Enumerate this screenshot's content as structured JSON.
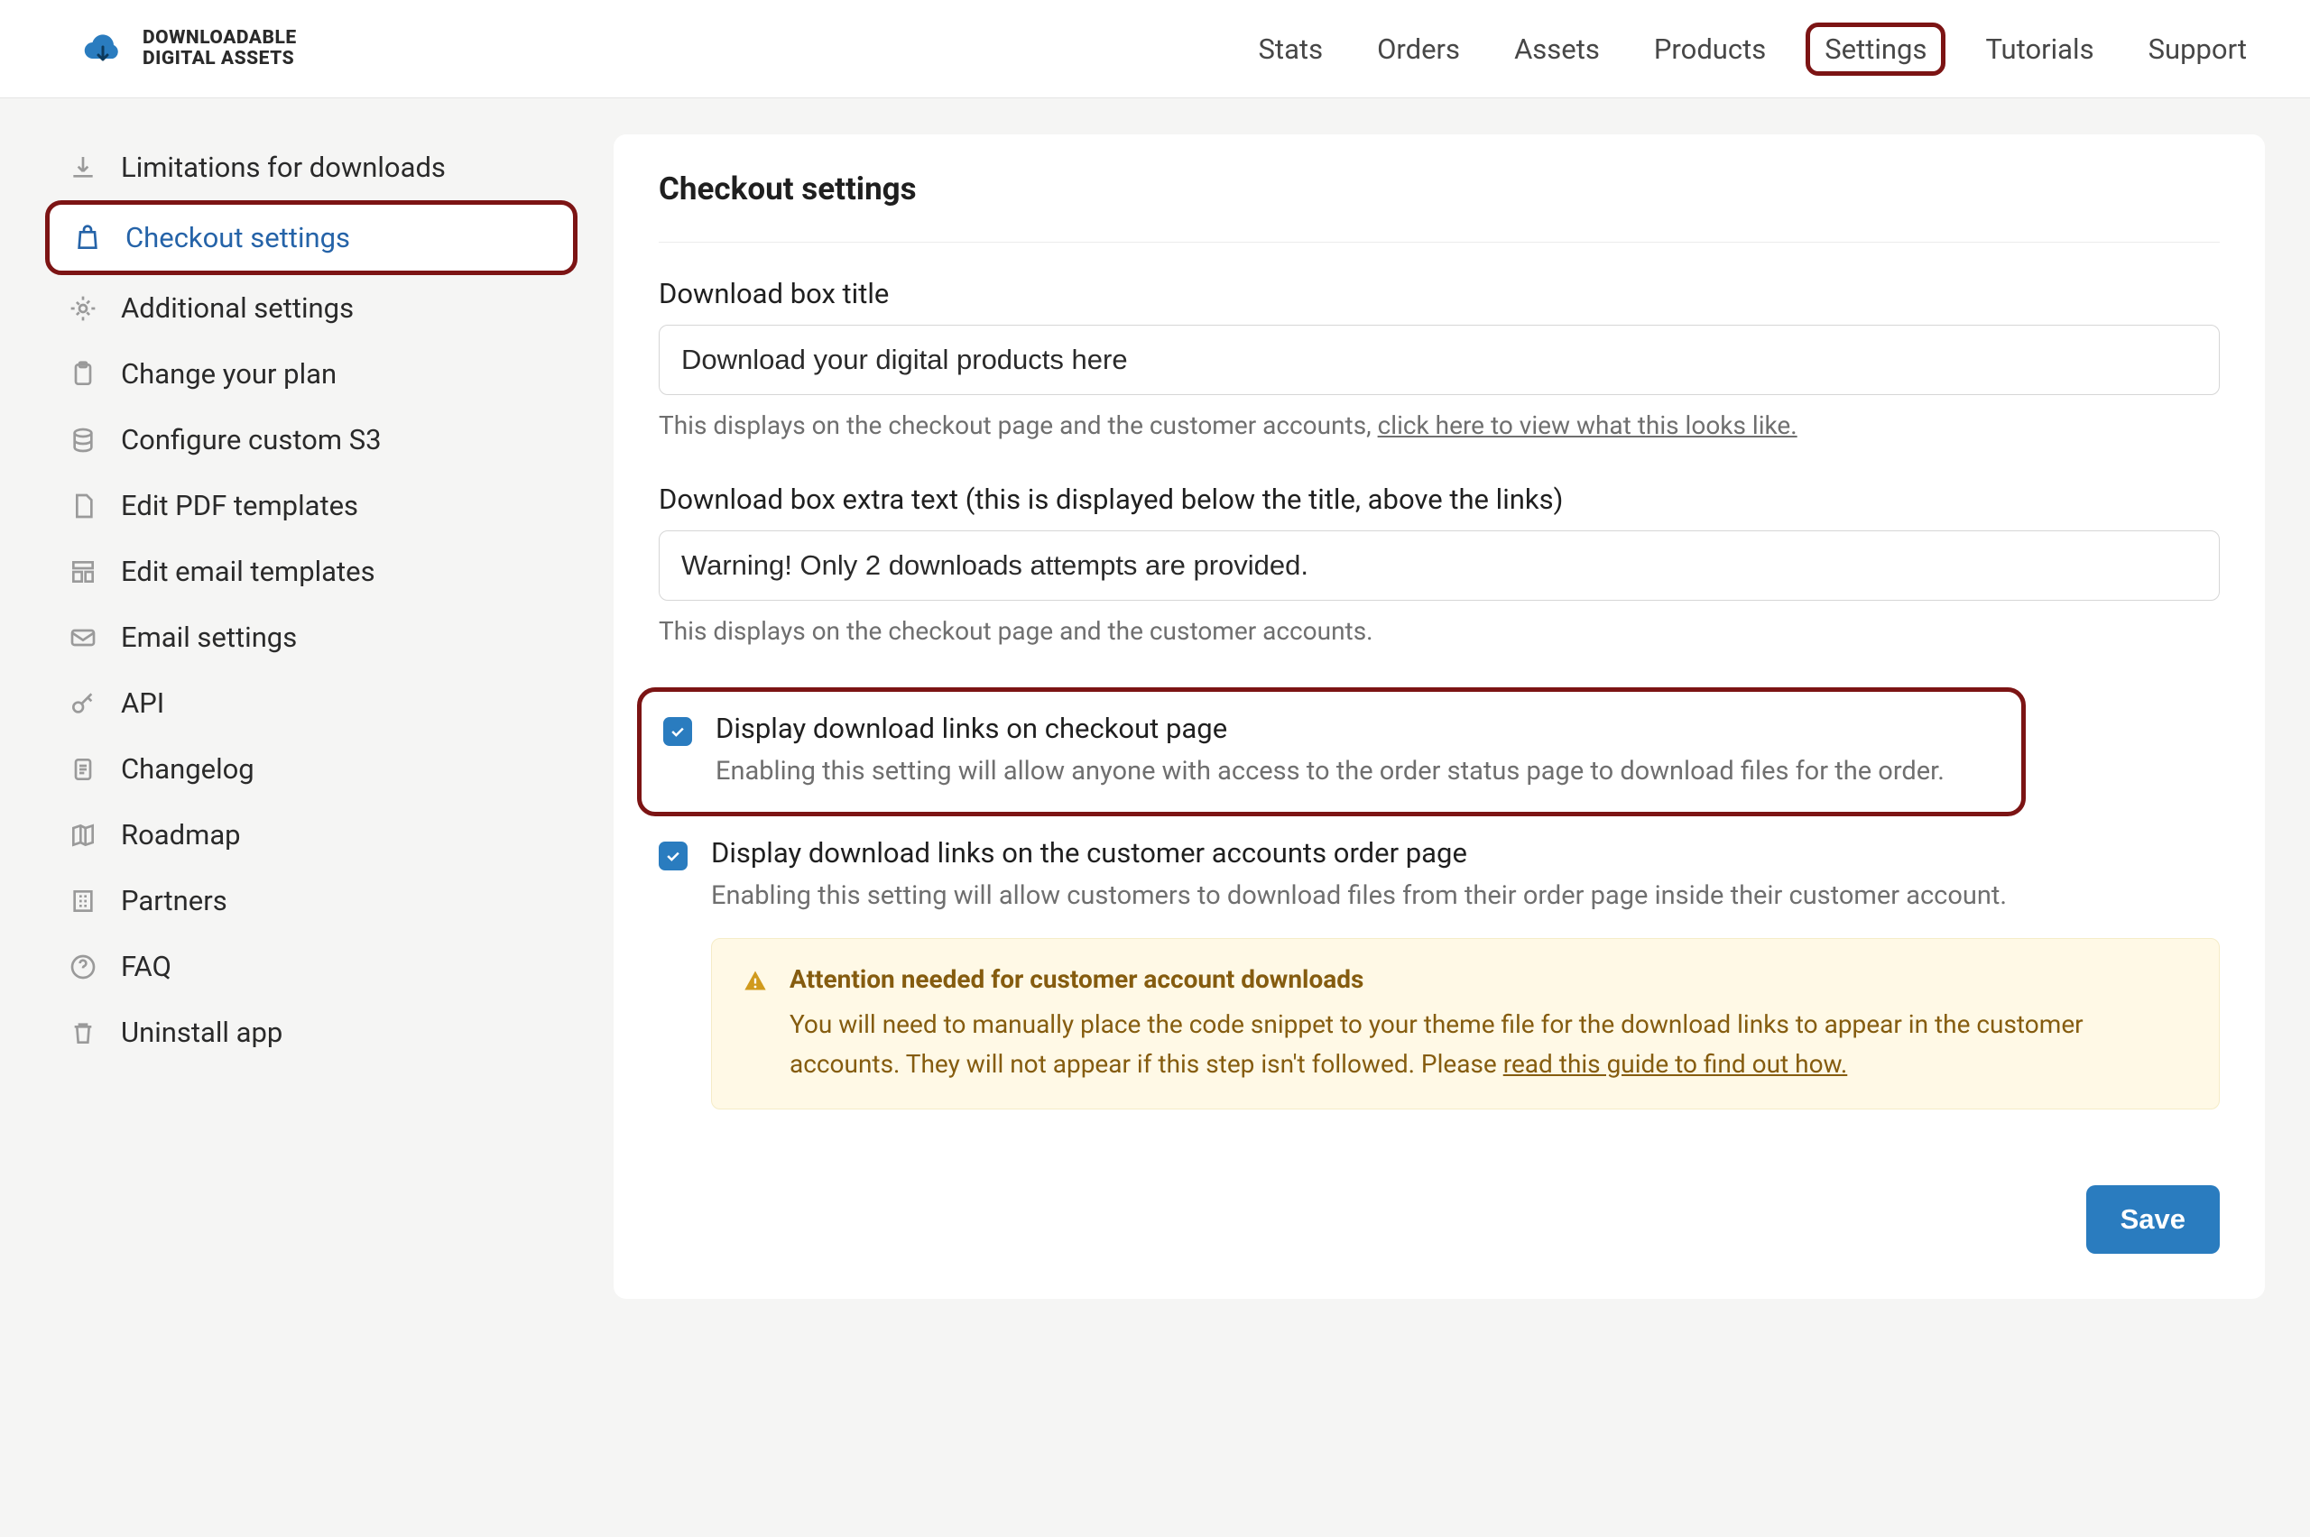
{
  "brand": {
    "line1": "DOWNLOADABLE",
    "line2": "DIGITAL ASSETS"
  },
  "nav": {
    "stats": "Stats",
    "orders": "Orders",
    "assets": "Assets",
    "products": "Products",
    "settings": "Settings",
    "tutorials": "Tutorials",
    "support": "Support"
  },
  "sidebar": {
    "limitations": "Limitations for downloads",
    "checkout": "Checkout settings",
    "additional": "Additional settings",
    "plan": "Change your plan",
    "s3": "Configure custom S3",
    "pdf": "Edit PDF templates",
    "email_templates": "Edit email templates",
    "email_settings": "Email settings",
    "api": "API",
    "changelog": "Changelog",
    "roadmap": "Roadmap",
    "partners": "Partners",
    "faq": "FAQ",
    "uninstall": "Uninstall app"
  },
  "page": {
    "title": "Checkout settings"
  },
  "form": {
    "title_label": "Download box title",
    "title_value": "Download your digital products here",
    "title_helper_prefix": "This displays on the checkout page and the customer accounts, ",
    "title_helper_link": "click here to view what this looks like.",
    "extra_label": "Download box extra text (this is displayed below the title, above the links)",
    "extra_value": "Warning! Only 2 downloads attempts are provided.",
    "extra_helper": "This displays on the checkout page and the customer accounts."
  },
  "check1": {
    "title": "Display download links on checkout page",
    "desc": "Enabling this setting will allow anyone with access to the order status page to download files for the order.",
    "checked": true
  },
  "check2": {
    "title": "Display download links on the customer accounts order page",
    "desc": "Enabling this setting will allow customers to download files from their order page inside their customer account.",
    "checked": true
  },
  "alert": {
    "title": "Attention needed for customer account downloads",
    "body_prefix": "You will need to manually place the code snippet to your theme file for the download links to appear in the customer accounts. They will not appear if this step isn't followed. Please ",
    "body_link": "read this guide to find out how."
  },
  "buttons": {
    "save": "Save"
  }
}
